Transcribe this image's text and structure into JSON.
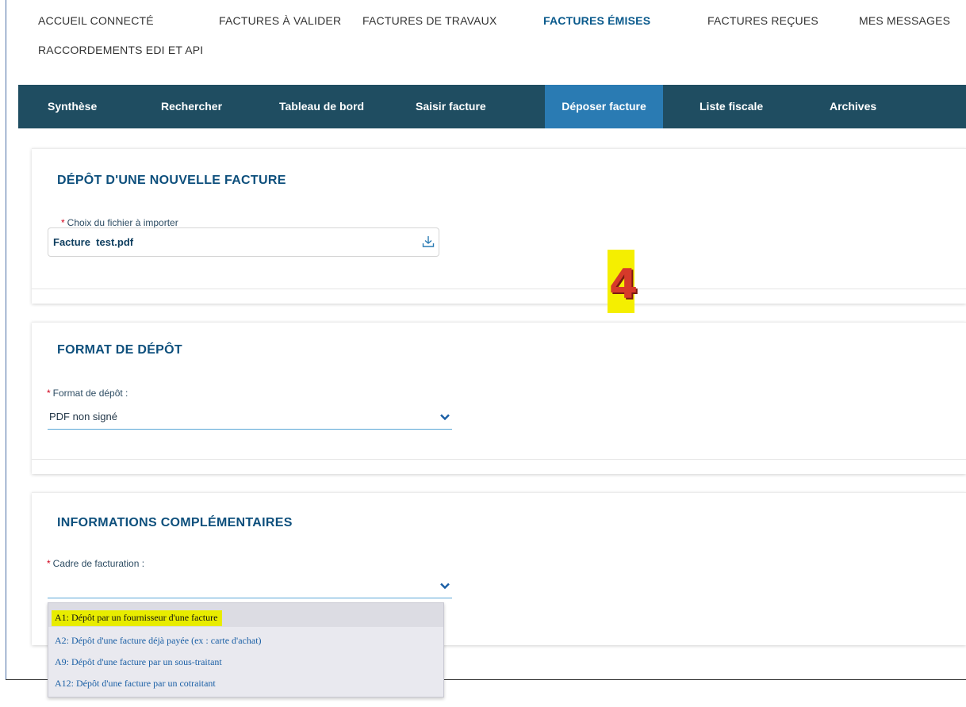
{
  "top_nav": [
    {
      "label": "Accueil connecté"
    },
    {
      "label": "Factures à valider"
    },
    {
      "label": "Factures de travaux"
    },
    {
      "label": "Factures émises",
      "active": true
    },
    {
      "label": "Factures reçues"
    },
    {
      "label": "Mes messages"
    },
    {
      "label": "Raccordements EDI et API"
    }
  ],
  "sub_nav": [
    {
      "label": "Synthèse"
    },
    {
      "label": "Rechercher"
    },
    {
      "label": "Tableau de bord"
    },
    {
      "label": "Saisir facture"
    },
    {
      "label": "Déposer facture",
      "active": true
    },
    {
      "label": "Liste fiscale"
    },
    {
      "label": "Archives"
    }
  ],
  "upload_section": {
    "title": "Dépôt d'une nouvelle facture",
    "required_mark": "*",
    "file_label": "Choix du fichier à importer",
    "file_value": "Facture  test.pdf",
    "icon": "download-icon"
  },
  "format_section": {
    "title": "Format de dépôt",
    "required_mark": "*",
    "field_label": "Format de dépôt :",
    "field_value": "PDF non signé",
    "icon": "chevron-down-icon"
  },
  "info_section": {
    "title": "Informations complémentaires",
    "required_mark": "*",
    "field_label": "Cadre de facturation :",
    "field_value": "",
    "icon": "chevron-down-icon"
  },
  "dropdown_options": [
    {
      "label": "A1: Dépôt par un fournisseur d'une facture",
      "highlighted": true
    },
    {
      "label": "A2: Dépôt d'une facture déjà payée (ex : carte d'achat)"
    },
    {
      "label": "A9: Dépôt d'une facture par un sous-traitant"
    },
    {
      "label": "A12: Dépôt d'une facture par un cotraitant"
    }
  ],
  "step_marker": "4",
  "colors": {
    "subnav_bg": "#1f4d61",
    "subnav_active": "#2a7bb3",
    "title_blue": "#0d4f7c",
    "highlight": "#e8ec00",
    "required": "#d0021b"
  }
}
